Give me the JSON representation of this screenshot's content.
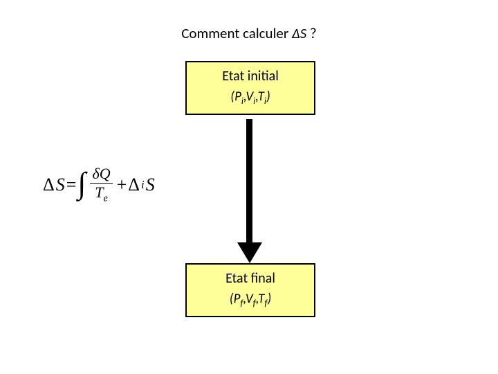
{
  "title": {
    "prefix": "Comment calculer ",
    "delta": "Δ",
    "S": "S",
    "suffix": " ?"
  },
  "initial": {
    "label": "Etat initial",
    "vars_open": "(",
    "P": "P",
    "Pi": "i",
    "sep1": ",",
    "V": "V",
    "Vi": "i",
    "sep2": ",",
    "T": "T",
    "Ti": "i",
    "vars_close": ")"
  },
  "final": {
    "label": "Etat final",
    "vars_open": "(",
    "P": "P",
    "Pf": "f",
    "sep1": ",",
    "V": "V",
    "Vf": "f",
    "sep2": ",",
    "T": "T",
    "Tf": "f",
    "vars_close": ")"
  },
  "equation": {
    "Delta1": "Δ",
    "S1": "S",
    "eq": " = ",
    "int": "∫",
    "num_delta": "δ",
    "num_Q": "Q",
    "den_T": "T",
    "den_e": "e",
    "plus": " + ",
    "Delta2": "Δ",
    "sub_i": "i",
    "S2": "S"
  }
}
